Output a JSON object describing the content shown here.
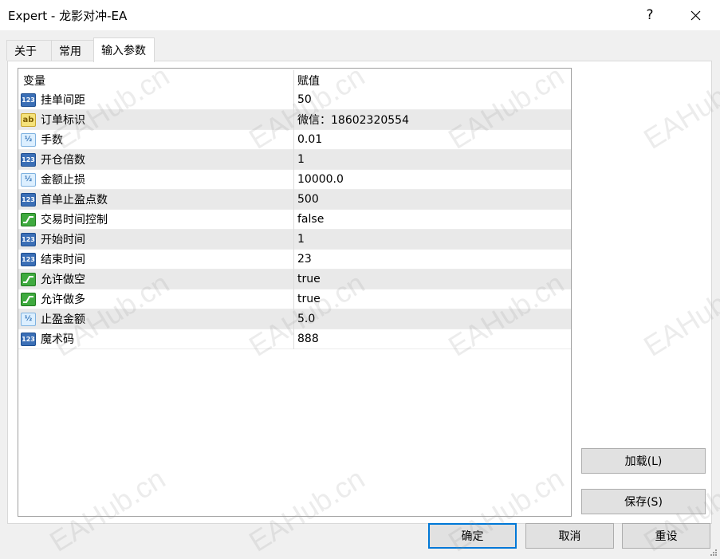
{
  "window": {
    "title": "Expert - 龙影对冲-EA",
    "help_label": "?"
  },
  "tabs": [
    {
      "label": "关于"
    },
    {
      "label": "常用"
    },
    {
      "label": "输入参数"
    }
  ],
  "active_tab": "输入参数",
  "grid": {
    "headers": {
      "variable": "变量",
      "value": "赋值"
    },
    "rows": [
      {
        "type": "int",
        "icon": "int-type-icon",
        "name": "挂单间距",
        "value": "50"
      },
      {
        "type": "string",
        "icon": "string-type-icon",
        "name": "订单标识",
        "value": "微信：18602320554"
      },
      {
        "type": "double",
        "icon": "double-type-icon",
        "name": "手数",
        "value": "0.01"
      },
      {
        "type": "int",
        "icon": "int-type-icon",
        "name": "开仓倍数",
        "value": "1"
      },
      {
        "type": "double",
        "icon": "double-type-icon",
        "name": "金额止损",
        "value": "10000.0"
      },
      {
        "type": "int",
        "icon": "int-type-icon",
        "name": "首单止盈点数",
        "value": "500"
      },
      {
        "type": "bool",
        "icon": "bool-type-icon",
        "name": "交易时间控制",
        "value": "false"
      },
      {
        "type": "int",
        "icon": "int-type-icon",
        "name": "开始时间",
        "value": "1"
      },
      {
        "type": "int",
        "icon": "int-type-icon",
        "name": "结束时间",
        "value": "23"
      },
      {
        "type": "bool",
        "icon": "bool-type-icon",
        "name": "允许做空",
        "value": "true"
      },
      {
        "type": "bool",
        "icon": "bool-type-icon",
        "name": "允许做多",
        "value": "true"
      },
      {
        "type": "double",
        "icon": "double-type-icon",
        "name": "止盈金额",
        "value": "5.0"
      },
      {
        "type": "int",
        "icon": "int-type-icon",
        "name": "魔术码",
        "value": "888"
      }
    ]
  },
  "icon_glyphs": {
    "int": "123",
    "string": "ab",
    "double": "½"
  },
  "side_buttons": {
    "load": "加载(L)",
    "save": "保存(S)"
  },
  "footer_buttons": {
    "ok": "确定",
    "cancel": "取消",
    "reset": "重设"
  },
  "watermark": "EAHub.cn",
  "colors": {
    "accent": "#0078d7",
    "row_alt": "#e9e9e9"
  }
}
